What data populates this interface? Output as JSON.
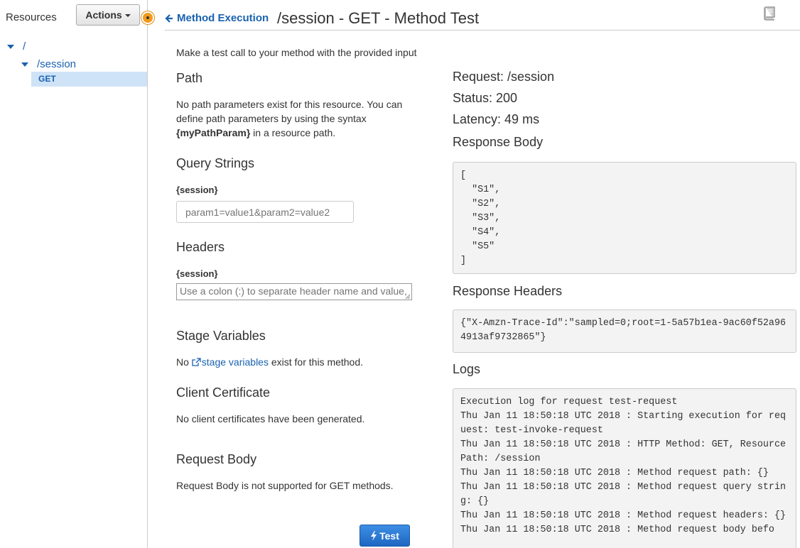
{
  "sidebar": {
    "title": "Resources",
    "actions_label": "Actions",
    "tree": {
      "root": "/",
      "session": "/session",
      "get": "GET"
    }
  },
  "header": {
    "back_label": "Method Execution",
    "title": "/session - GET - Method Test"
  },
  "intro": "Make a test call to your method with the provided input",
  "path": {
    "heading": "Path",
    "line1": "No path parameters exist for this resource. You can",
    "line2": "define path parameters by using the syntax",
    "syntax": "{myPathParam}",
    "line3_rest": " in a resource path."
  },
  "query_strings": {
    "heading": "Query Strings",
    "label": "{session}",
    "placeholder": "param1=value1&param2=value2"
  },
  "headers_section": {
    "heading": "Headers",
    "label": "{session}",
    "placeholder": "Use a colon (:) to separate header name and value,"
  },
  "stage_variables": {
    "heading": "Stage Variables",
    "prefix": "No ",
    "link": "stage variables",
    "suffix": " exist for this method."
  },
  "client_certificate": {
    "heading": "Client Certificate",
    "text": "No client certificates have been generated."
  },
  "request_body": {
    "heading": "Request Body",
    "text": "Request Body is not supported for GET methods."
  },
  "test_button": "Test",
  "result": {
    "request": "Request: /session",
    "status": "Status: 200",
    "latency": "Latency: 49 ms",
    "response_body_heading": "Response Body",
    "response_body": "[\n  \"S1\",\n  \"S2\",\n  \"S3\",\n  \"S4\",\n  \"S5\"\n]",
    "response_headers_heading": "Response Headers",
    "response_headers": "{\"X-Amzn-Trace-Id\":\"sampled=0;root=1-5a57b1ea-9ac60f52a964913af9732865\"}",
    "logs_heading": "Logs",
    "logs": "Execution log for request test-request\nThu Jan 11 18:50:18 UTC 2018 : Starting execution for request: test-invoke-request\nThu Jan 11 18:50:18 UTC 2018 : HTTP Method: GET, Resource Path: /session\nThu Jan 11 18:50:18 UTC 2018 : Method request path: {}\nThu Jan 11 18:50:18 UTC 2018 : Method request query string: {}\nThu Jan 11 18:50:18 UTC 2018 : Method request headers: {}\nThu Jan 11 18:50:18 UTC 2018 : Method request body befo"
  },
  "colors": {
    "link": "#1a62b0",
    "selected_bg": "#cfe3f7",
    "orange": "#f19a1b",
    "button_blue": "#1e66c2"
  }
}
